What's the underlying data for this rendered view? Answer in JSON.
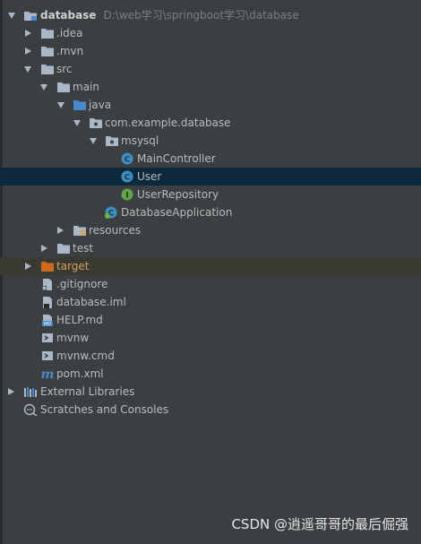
{
  "project": {
    "name": "database",
    "path": "D:\\web学习\\springboot学习\\database"
  },
  "tree": {
    "idea": ".idea",
    "mvn": ".mvn",
    "src": "src",
    "main": "main",
    "java": "java",
    "package": "com.example.database",
    "mysql": "msysql",
    "main_controller": "MainController",
    "user": "User",
    "user_repository": "UserRepository",
    "database_application": "DatabaseApplication",
    "resources": "resources",
    "test": "test",
    "target": "target",
    "gitignore": ".gitignore",
    "database_iml": "database.iml",
    "help_md": "HELP.md",
    "mvnw": "mvnw",
    "mvnw_cmd": "mvnw.cmd",
    "pom_xml": "pom.xml",
    "external_libraries": "External Libraries",
    "scratches": "Scratches and Consoles"
  },
  "watermark": "CSDN @逍遥哥哥的最后倔强",
  "colors": {
    "background": "#3c3f41",
    "selection": "#0d293e",
    "excluded_row": "#3b3a32",
    "folder": "#a9b7c6",
    "source_folder": "#4a88c7",
    "excluded_folder": "#d06a1a",
    "class_icon": "#3d8fc2",
    "interface_icon": "#5fa34b"
  },
  "icons": {
    "module": "module-folder-icon",
    "folder": "folder-icon",
    "source_root": "source-root-icon",
    "package": "package-icon",
    "class": "class-icon",
    "interface": "interface-icon",
    "spring_boot_app": "spring-boot-app-icon",
    "resources_root": "resources-root-icon",
    "excluded": "excluded-folder-icon",
    "text_file": "text-file-icon",
    "iml_file": "iml-file-icon",
    "markdown_file": "markdown-file-icon",
    "script_file": "script-file-icon",
    "maven_file": "maven-file-icon",
    "libraries": "libraries-icon",
    "scratches": "scratches-icon"
  }
}
